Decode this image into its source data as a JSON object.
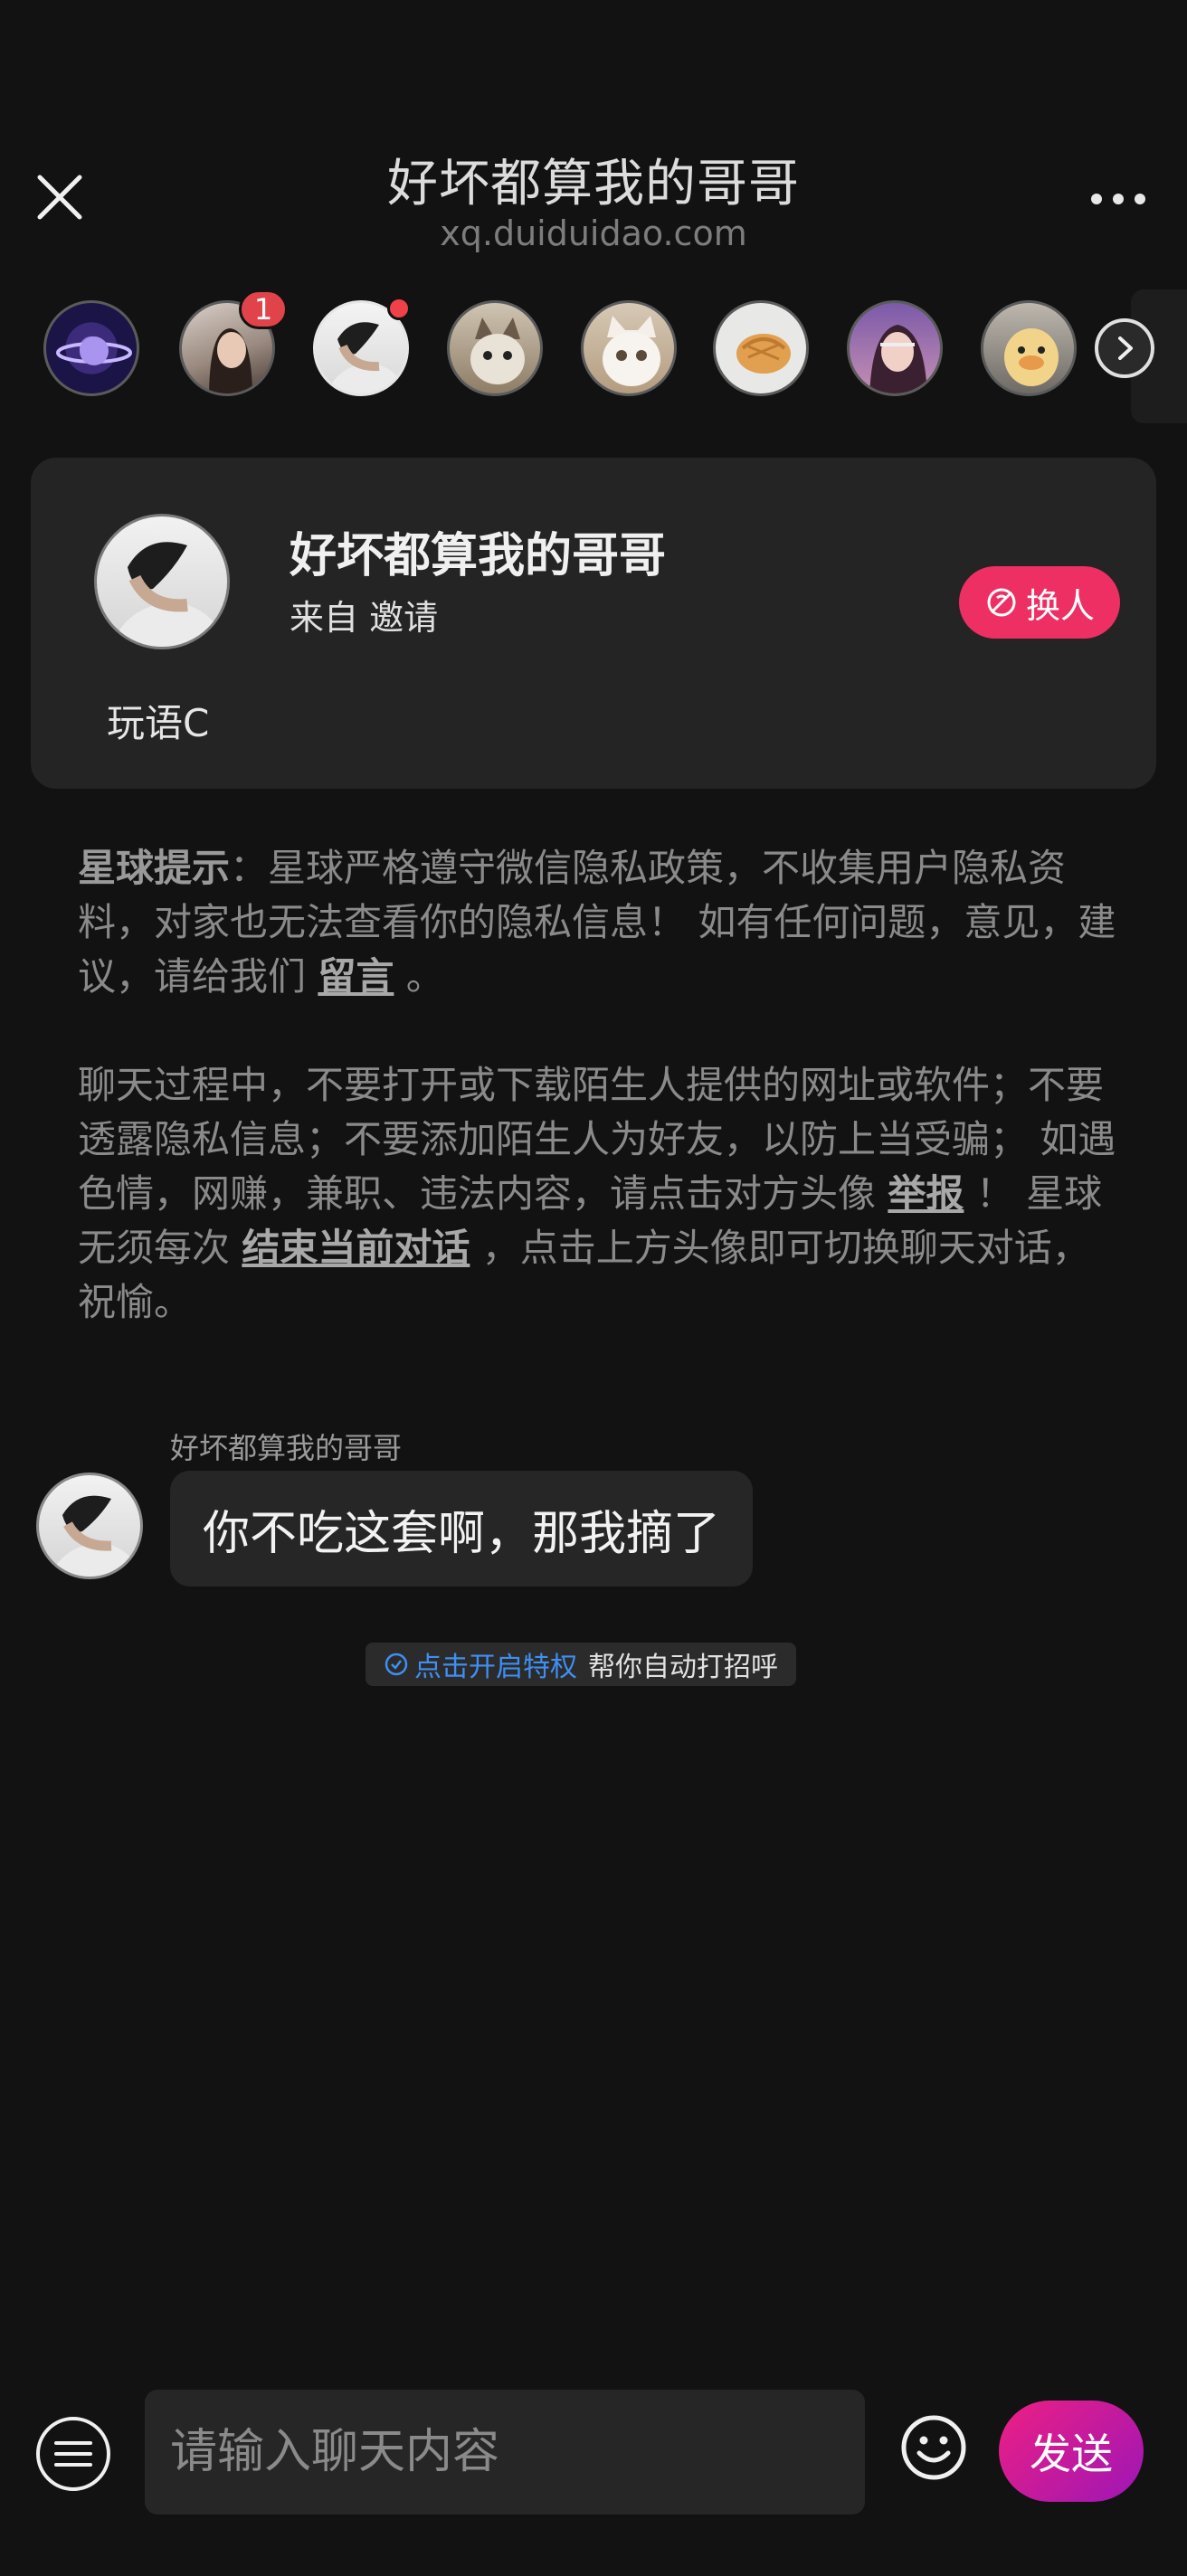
{
  "header": {
    "title": "好坏都算我的哥哥",
    "subtitle": "xq.duiduidao.com",
    "close_icon": "close-icon",
    "more_icon": "more-icon"
  },
  "avatar_strip": {
    "items": [
      {
        "name": "planet",
        "badge": null
      },
      {
        "name": "girl",
        "badge": "1"
      },
      {
        "name": "current-chat",
        "badge_dot": true,
        "selected": true
      },
      {
        "name": "cat-hat",
        "badge": null
      },
      {
        "name": "white-cat",
        "badge": null
      },
      {
        "name": "pastry",
        "badge": null
      },
      {
        "name": "pink-girl",
        "badge": null
      },
      {
        "name": "duck",
        "badge": null
      }
    ],
    "next_icon": "chevron-right-icon"
  },
  "card": {
    "name": "好坏都算我的哥哥",
    "from": "来自 邀请",
    "swap_label": "换人",
    "tag": "玩语C"
  },
  "notice": {
    "label": "星球提示",
    "text1": "：星球严格遵守微信隐私政策，不收集用户隐私资料，对家也无法查看你的隐私信息！ 如有任何问题，意见，建议，请给我们 ",
    "link_feedback": "留言",
    "text2": " 。",
    "p2_a": "聊天过程中，不要打开或下载陌生人提供的网址或软件；不要透露隐私信息；不要添加陌生人为好友，以防上当受骗； 如遇色情，网赚，兼职、违法内容，请点击对方头像 ",
    "link_report": "举报",
    "p2_b": " ！ 星球无须每次 ",
    "link_end": "结束当前对话",
    "p2_c": " ，点击上方头像即可切换聊天对话，祝愉。"
  },
  "message": {
    "sender": "好坏都算我的哥哥",
    "text": "你不吃这套啊，那我摘了"
  },
  "privilege": {
    "link": "点击开启特权",
    "text": "帮你自动打招呼"
  },
  "bottom": {
    "placeholder": "请输入聊天内容",
    "send_label": "发送"
  },
  "colors": {
    "background": "#121212",
    "card": "#242424",
    "swap_button": "#ee2f63",
    "send_gradient_start": "#ee1f83",
    "send_gradient_end": "#9d16b6",
    "privilege_link": "#3f8ff2"
  }
}
